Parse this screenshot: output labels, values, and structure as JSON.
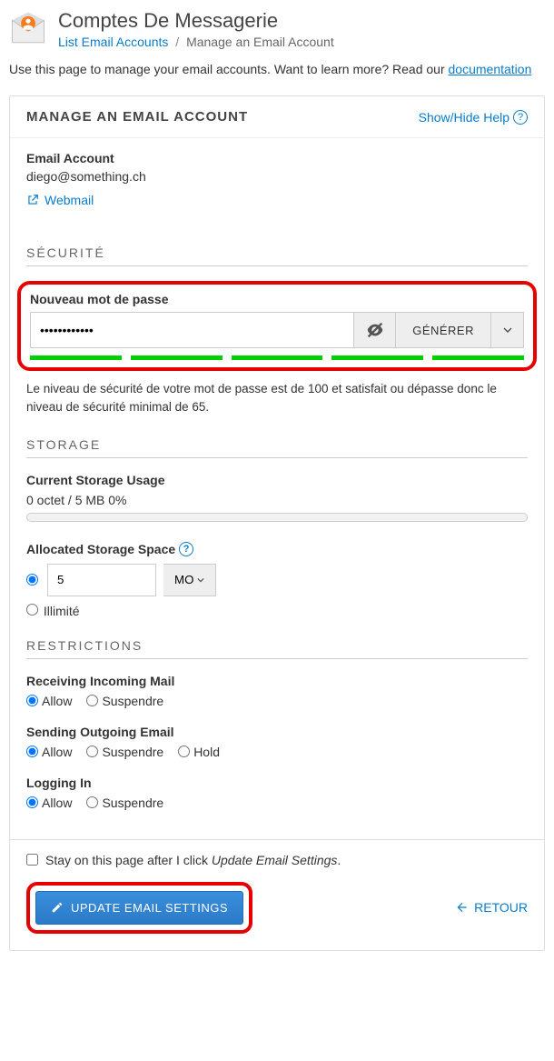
{
  "header": {
    "title": "Comptes De Messagerie",
    "breadcrumb_link": "List Email Accounts",
    "breadcrumb_current": "Manage an Email Account"
  },
  "intro": {
    "text": "Use this page to manage your email accounts. Want to learn more? Read our ",
    "doc_link": "documentation"
  },
  "panel": {
    "title": "MANAGE AN EMAIL ACCOUNT",
    "help": "Show/Hide Help"
  },
  "account": {
    "label": "Email Account",
    "email": "diego@something.ch",
    "webmail": "Webmail"
  },
  "security": {
    "title": "SÉCURITÉ",
    "pw_label": "Nouveau mot de passe",
    "pw_value": "••••••••••••",
    "generate": "GÉNÉRER",
    "strength_text": "Le niveau de sécurité de votre mot de passe est de 100 et satisfait ou dépasse donc le niveau de sécurité minimal de 65."
  },
  "storage": {
    "title": "STORAGE",
    "usage_label": "Current Storage Usage",
    "usage_value": "0 octet / 5 MB 0%",
    "alloc_label": "Allocated Storage Space",
    "alloc_value": "5",
    "unit": "MO",
    "unlimited": "Illimité"
  },
  "restrictions": {
    "title": "RESTRICTIONS",
    "incoming": {
      "label": "Receiving Incoming Mail",
      "allow": "Allow",
      "suspend": "Suspendre"
    },
    "outgoing": {
      "label": "Sending Outgoing Email",
      "allow": "Allow",
      "suspend": "Suspendre",
      "hold": "Hold"
    },
    "login": {
      "label": "Logging In",
      "allow": "Allow",
      "suspend": "Suspendre"
    }
  },
  "footer": {
    "stay_prefix": "Stay on this page after I click ",
    "stay_em": "Update Email Settings",
    "submit": "UPDATE EMAIL SETTINGS",
    "back": "RETOUR"
  }
}
